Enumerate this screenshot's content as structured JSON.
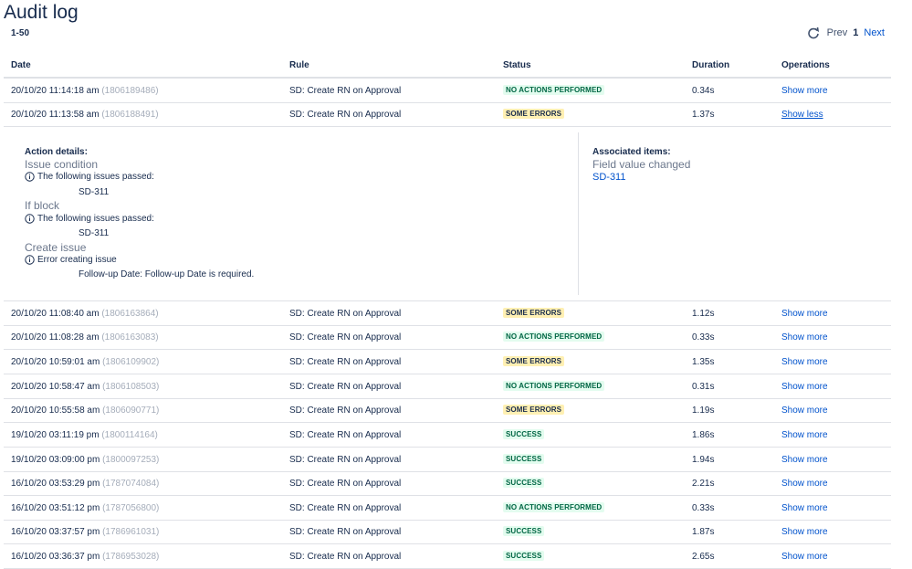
{
  "page": {
    "title": "Audit log",
    "range": "1-50",
    "pager": {
      "prev": "Prev",
      "current": "1",
      "next": "Next"
    }
  },
  "columns": {
    "date": "Date",
    "rule": "Rule",
    "status": "Status",
    "duration": "Duration",
    "operations": "Operations"
  },
  "rows": [
    {
      "date": "20/10/20 11:14:18 am",
      "id": "(1806189486)",
      "rule": "SD: Create RN on Approval",
      "status": "NO ACTIONS PERFORMED",
      "status_kind": "no",
      "duration": "0.34s",
      "op": "Show more"
    },
    {
      "date": "20/10/20 11:13:58 am",
      "id": "(1806188491)",
      "rule": "SD: Create RN on Approval",
      "status": "SOME ERRORS",
      "status_kind": "err",
      "duration": "1.37s",
      "op": "Show less"
    },
    {
      "date": "20/10/20 11:08:40 am",
      "id": "(1806163864)",
      "rule": "SD: Create RN on Approval",
      "status": "SOME ERRORS",
      "status_kind": "err",
      "duration": "1.12s",
      "op": "Show more"
    },
    {
      "date": "20/10/20 11:08:28 am",
      "id": "(1806163083)",
      "rule": "SD: Create RN on Approval",
      "status": "NO ACTIONS PERFORMED",
      "status_kind": "no",
      "duration": "0.33s",
      "op": "Show more"
    },
    {
      "date": "20/10/20 10:59:01 am",
      "id": "(1806109902)",
      "rule": "SD: Create RN on Approval",
      "status": "SOME ERRORS",
      "status_kind": "err",
      "duration": "1.35s",
      "op": "Show more"
    },
    {
      "date": "20/10/20 10:58:47 am",
      "id": "(1806108503)",
      "rule": "SD: Create RN on Approval",
      "status": "NO ACTIONS PERFORMED",
      "status_kind": "no",
      "duration": "0.31s",
      "op": "Show more"
    },
    {
      "date": "20/10/20 10:55:58 am",
      "id": "(1806090771)",
      "rule": "SD: Create RN on Approval",
      "status": "SOME ERRORS",
      "status_kind": "err",
      "duration": "1.19s",
      "op": "Show more"
    },
    {
      "date": "19/10/20 03:11:19 pm",
      "id": "(1800114164)",
      "rule": "SD: Create RN on Approval",
      "status": "SUCCESS",
      "status_kind": "ok",
      "duration": "1.86s",
      "op": "Show more"
    },
    {
      "date": "19/10/20 03:09:00 pm",
      "id": "(1800097253)",
      "rule": "SD: Create RN on Approval",
      "status": "SUCCESS",
      "status_kind": "ok",
      "duration": "1.94s",
      "op": "Show more"
    },
    {
      "date": "16/10/20 03:53:29 pm",
      "id": "(1787074084)",
      "rule": "SD: Create RN on Approval",
      "status": "SUCCESS",
      "status_kind": "ok",
      "duration": "2.21s",
      "op": "Show more"
    },
    {
      "date": "16/10/20 03:51:12 pm",
      "id": "(1787056800)",
      "rule": "SD: Create RN on Approval",
      "status": "NO ACTIONS PERFORMED",
      "status_kind": "no",
      "duration": "0.33s",
      "op": "Show more"
    },
    {
      "date": "16/10/20 03:37:57 pm",
      "id": "(1786961031)",
      "rule": "SD: Create RN on Approval",
      "status": "SUCCESS",
      "status_kind": "ok",
      "duration": "1.87s",
      "op": "Show more"
    },
    {
      "date": "16/10/20 03:36:37 pm",
      "id": "(1786953028)",
      "rule": "SD: Create RN on Approval",
      "status": "SUCCESS",
      "status_kind": "ok",
      "duration": "2.65s",
      "op": "Show more"
    }
  ],
  "details": {
    "action_heading": "Action details:",
    "sections": [
      {
        "name": "Issue condition",
        "message": "The following issues passed:",
        "value": "SD-311"
      },
      {
        "name": "If block",
        "message": "The following issues passed:",
        "value": "SD-311"
      },
      {
        "name": "Create issue",
        "message": "Error creating issue",
        "value": "Follow-up Date: Follow-up Date is required."
      }
    ],
    "associated_heading": "Associated items:",
    "associated_label": "Field value changed",
    "associated_link": "SD-311"
  },
  "colors": {
    "link": "#0052cc",
    "badge_green_bg": "#e3fcef",
    "badge_green_text": "#006644",
    "badge_yellow_bg": "#fff0b3",
    "id_grey": "#a5adba"
  },
  "icons": {
    "refresh": "refresh-icon",
    "info": "info-icon"
  }
}
